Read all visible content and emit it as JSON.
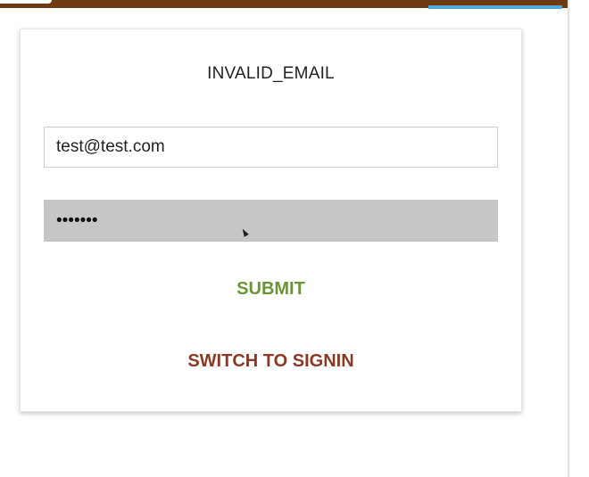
{
  "auth_form": {
    "error_message": "INVALID_EMAIL",
    "email_value": "test@test.com",
    "password_value": "•••••••",
    "submit_label": "SUBMIT",
    "switch_label": "SWITCH TO SIGNIN"
  },
  "colors": {
    "header_bar": "#6e3a12",
    "header_accent": "#4fa9d8",
    "submit": "#6b9436",
    "switch": "#8a3a24",
    "password_bg": "#c6c6c6"
  }
}
